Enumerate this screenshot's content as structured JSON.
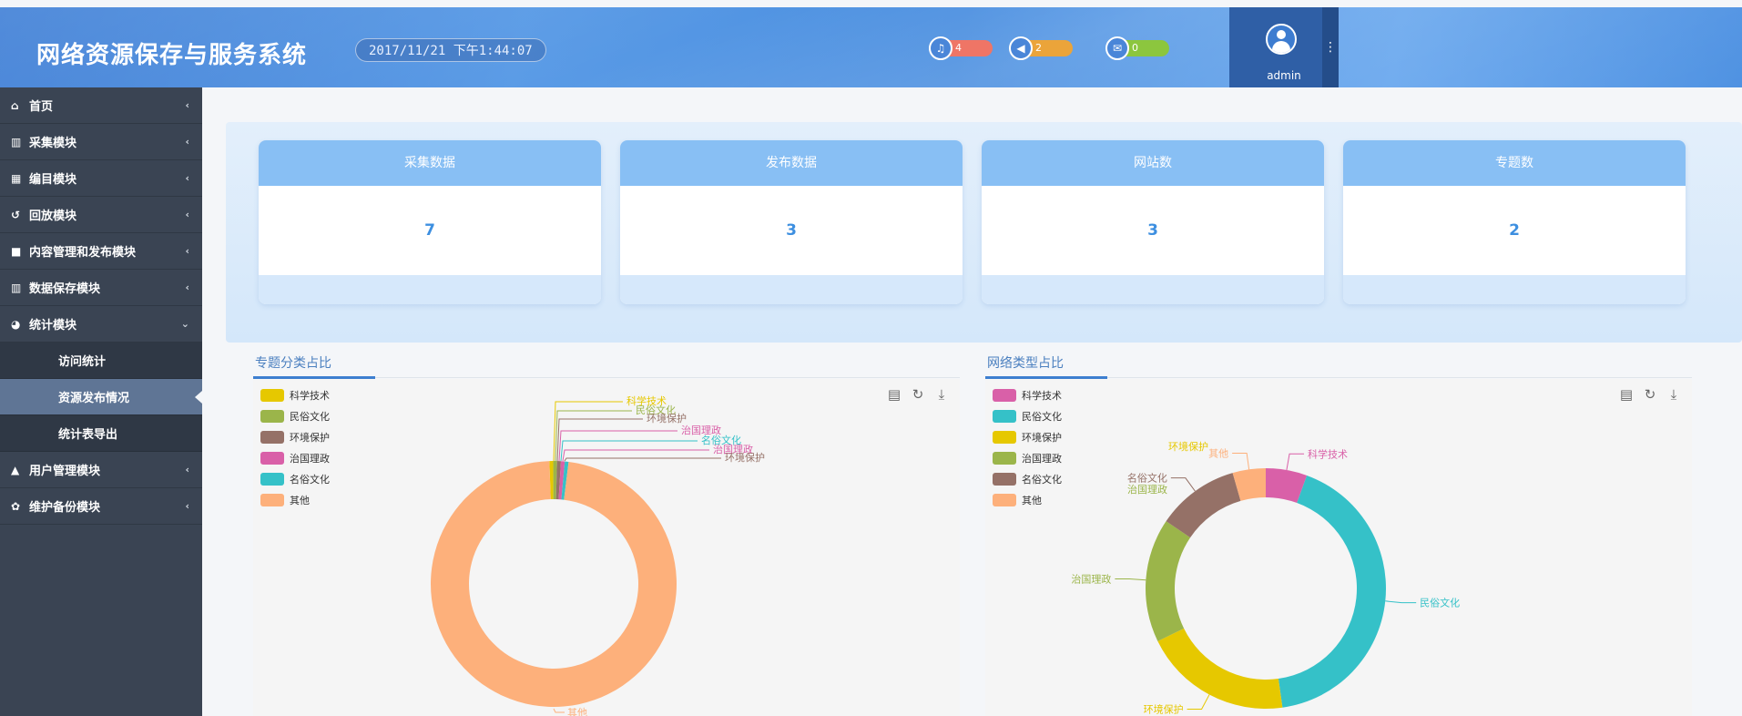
{
  "header": {
    "title": "网络资源保存与服务系统",
    "datetime": "2017/11/21 下午1:44:07",
    "notifications": [
      {
        "icon": "bell-icon",
        "glyph": "♫",
        "count": "4",
        "color": "#ef7566"
      },
      {
        "icon": "speaker-icon",
        "glyph": "◀",
        "count": "2",
        "color": "#eba43a"
      },
      {
        "icon": "mail-icon",
        "glyph": "✉",
        "count": "0",
        "color": "#8cc63e"
      }
    ],
    "user": {
      "name": "admin",
      "menu_glyph": "⋮"
    }
  },
  "sidebar": {
    "items": [
      {
        "label": "首页",
        "icon": "home-icon",
        "glyph": "⌂",
        "chevron": "‹"
      },
      {
        "label": "采集模块",
        "icon": "bar-chart-icon",
        "glyph": "▥",
        "chevron": "‹"
      },
      {
        "label": "编目模块",
        "icon": "calendar-icon",
        "glyph": "▦",
        "chevron": "‹"
      },
      {
        "label": "回放模块",
        "icon": "history-icon",
        "glyph": "↺",
        "chevron": "‹"
      },
      {
        "label": "内容管理和发布模块",
        "icon": "briefcase-icon",
        "glyph": "■",
        "chevron": "‹"
      },
      {
        "label": "数据保存模块",
        "icon": "bar-chart-icon",
        "glyph": "▥",
        "chevron": "‹"
      },
      {
        "label": "统计模块",
        "icon": "pie-chart-icon",
        "glyph": "◕",
        "chevron": "⌄"
      }
    ],
    "sub_items": [
      {
        "label": "访问统计",
        "active": false
      },
      {
        "label": "资源发布情况",
        "active": true
      },
      {
        "label": "统计表导出",
        "active": false
      }
    ],
    "bottom_items": [
      {
        "label": "用户管理模块",
        "icon": "user-icon",
        "glyph": "▲",
        "chevron": "‹"
      },
      {
        "label": "维护备份模块",
        "icon": "gear-icon",
        "glyph": "✿",
        "chevron": "‹"
      }
    ]
  },
  "stats": [
    {
      "label": "采集数据",
      "value": "7"
    },
    {
      "label": "发布数据",
      "value": "3"
    },
    {
      "label": "网站数",
      "value": "3"
    },
    {
      "label": "专题数",
      "value": "2"
    }
  ],
  "toolbox": [
    {
      "icon": "data-view-icon",
      "glyph": "▤"
    },
    {
      "icon": "refresh-icon",
      "glyph": "↻"
    },
    {
      "icon": "download-icon",
      "glyph": "⤓"
    }
  ],
  "chart_data": [
    {
      "type": "pie",
      "title": "专题分类占比",
      "donut": true,
      "legend_position": "top-left",
      "categories": [
        "科学技术",
        "民俗文化",
        "环境保护",
        "治国理政",
        "名俗文化",
        "其他"
      ],
      "colors": [
        "#e6c800",
        "#9bb54a",
        "#957167",
        "#d960a8",
        "#35c1c8",
        "#fdb07b"
      ],
      "values": [
        0.5,
        0.5,
        0.5,
        0.5,
        0.5,
        97.5
      ],
      "slice_labels": [
        "科学技术",
        "民俗文化",
        "环境保护",
        "治国理政",
        "名俗文化",
        "其他"
      ],
      "extra_labels": [
        "治国理政",
        "环境保护"
      ]
    },
    {
      "type": "pie",
      "title": "网络类型占比",
      "donut": true,
      "legend_position": "top-left",
      "categories": [
        "科学技术",
        "民俗文化",
        "环境保护",
        "治国理政",
        "名俗文化",
        "其他"
      ],
      "colors": [
        "#d960a8",
        "#35c1c8",
        "#e6c800",
        "#9bb54a",
        "#957167",
        "#fdb07b"
      ],
      "values": [
        5,
        38,
        18,
        15,
        10,
        4
      ],
      "slice_labels": [
        "科学技术",
        "民俗文化",
        "环境保护",
        "治国理政",
        "名俗文化",
        "其他"
      ],
      "extra_labels": [
        "治国理政",
        "环境保护"
      ]
    }
  ]
}
